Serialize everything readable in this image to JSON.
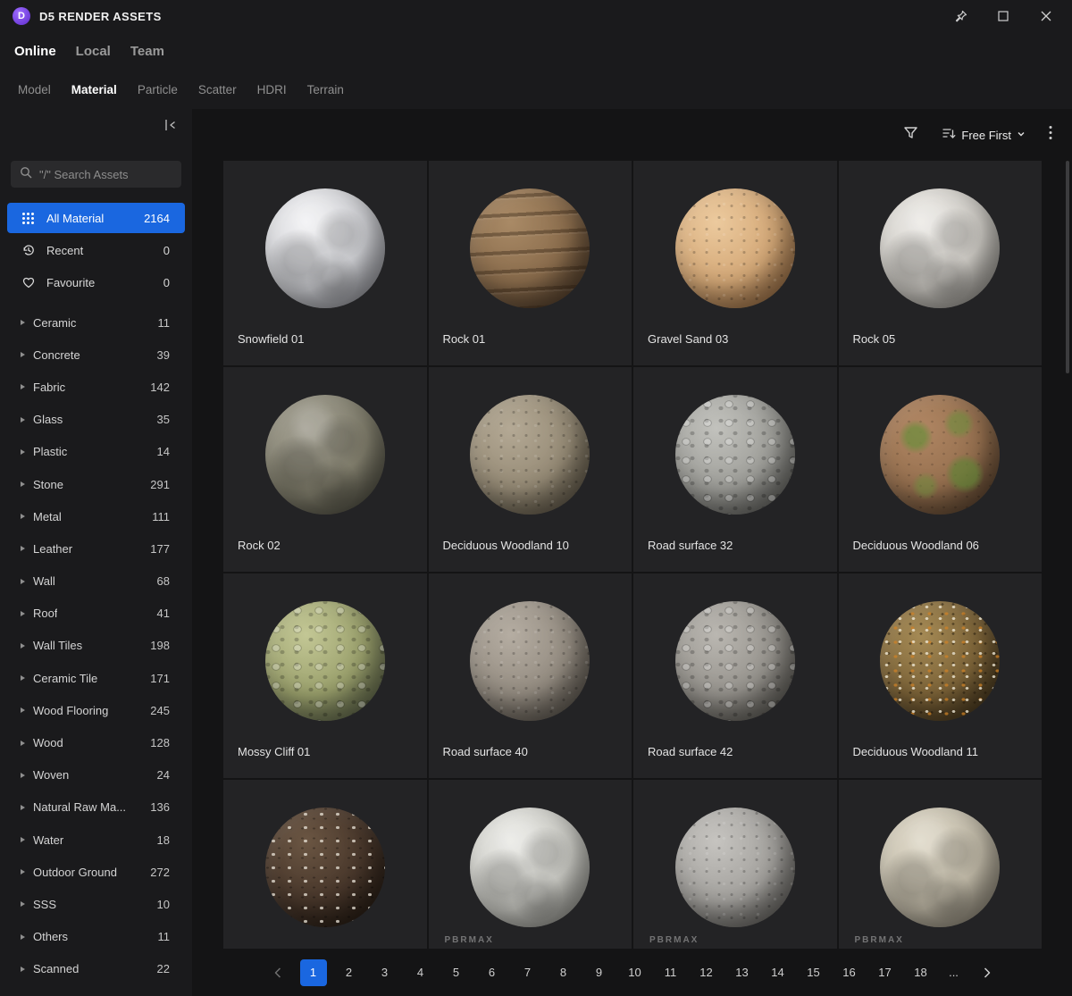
{
  "window": {
    "title": "D5 RENDER ASSETS",
    "logo_letter": "D"
  },
  "colors": {
    "accent": "#1a67e0"
  },
  "source_tabs": [
    {
      "label": "Online",
      "active": true
    },
    {
      "label": "Local",
      "active": false
    },
    {
      "label": "Team",
      "active": false
    }
  ],
  "type_tabs": [
    {
      "label": "Model",
      "active": false
    },
    {
      "label": "Material",
      "active": true
    },
    {
      "label": "Particle",
      "active": false
    },
    {
      "label": "Scatter",
      "active": false
    },
    {
      "label": "HDRI",
      "active": false
    },
    {
      "label": "Terrain",
      "active": false
    }
  ],
  "sidebar": {
    "search": {
      "placeholder": "\"/\" Search Assets"
    },
    "pinned": [
      {
        "label": "All Material",
        "count": "2164",
        "icon": "grid-dots-icon",
        "active": true
      },
      {
        "label": "Recent",
        "count": "0",
        "icon": "history-icon",
        "active": false
      },
      {
        "label": "Favourite",
        "count": "0",
        "icon": "heart-icon",
        "active": false
      }
    ],
    "categories": [
      {
        "label": "Ceramic",
        "count": "11"
      },
      {
        "label": "Concrete",
        "count": "39"
      },
      {
        "label": "Fabric",
        "count": "142"
      },
      {
        "label": "Glass",
        "count": "35"
      },
      {
        "label": "Plastic",
        "count": "14"
      },
      {
        "label": "Stone",
        "count": "291"
      },
      {
        "label": "Metal",
        "count": "111"
      },
      {
        "label": "Leather",
        "count": "177"
      },
      {
        "label": "Wall",
        "count": "68"
      },
      {
        "label": "Roof",
        "count": "41"
      },
      {
        "label": "Wall Tiles",
        "count": "198"
      },
      {
        "label": "Ceramic Tile",
        "count": "171"
      },
      {
        "label": "Wood Flooring",
        "count": "245"
      },
      {
        "label": "Wood",
        "count": "128"
      },
      {
        "label": "Woven",
        "count": "24"
      },
      {
        "label": "Natural Raw Ma...",
        "count": "136"
      },
      {
        "label": "Water",
        "count": "18"
      },
      {
        "label": "Outdoor Ground",
        "count": "272"
      },
      {
        "label": "SSS",
        "count": "10"
      },
      {
        "label": "Others",
        "count": "11"
      },
      {
        "label": "Scanned",
        "count": "22"
      }
    ]
  },
  "toolbar": {
    "sort_label": "Free First"
  },
  "materials": [
    {
      "name": "Snowfield 01",
      "c1": "#f2f2f4",
      "c2": "#cfd0d4",
      "c3": "#8e8f96",
      "texture": "mottle",
      "watermark": ""
    },
    {
      "name": "Rock 01",
      "c1": "#a98a66",
      "c2": "#8a6c4c",
      "c3": "#4e3a28",
      "texture": "striated",
      "watermark": ""
    },
    {
      "name": "Gravel Sand 03",
      "c1": "#ecca9e",
      "c2": "#d4a877",
      "c3": "#97693f",
      "texture": "speckle",
      "watermark": ""
    },
    {
      "name": "Rock 05",
      "c1": "#eceae6",
      "c2": "#cfccc6",
      "c3": "#93908a",
      "texture": "mottle",
      "watermark": ""
    },
    {
      "name": "Rock 02",
      "c1": "#a3a093",
      "c2": "#84816f",
      "c3": "#4b4a3e",
      "texture": "mottle",
      "watermark": ""
    },
    {
      "name": "Deciduous Woodland 10",
      "c1": "#b4a995",
      "c2": "#968b76",
      "c3": "#5c5444",
      "texture": "speckle",
      "watermark": ""
    },
    {
      "name": "Road surface 32",
      "c1": "#c2c2bd",
      "c2": "#9e9e99",
      "c3": "#5f5f5b",
      "texture": "pebble",
      "watermark": ""
    },
    {
      "name": "Deciduous Woodland 06",
      "c1": "#b08663",
      "c2": "#96704f",
      "c3": "#56402c",
      "texture": "moss",
      "watermark": ""
    },
    {
      "name": "Mossy Cliff 01",
      "c1": "#c3c795",
      "c2": "#9aa06c",
      "c3": "#5c644a",
      "texture": "pebble",
      "watermark": ""
    },
    {
      "name": "Road surface 40",
      "c1": "#b5ada2",
      "c2": "#948c81",
      "c3": "#58524a",
      "texture": "speckle",
      "watermark": ""
    },
    {
      "name": "Road surface 42",
      "c1": "#bab7b1",
      "c2": "#96938d",
      "c3": "#585650",
      "texture": "pebble",
      "watermark": ""
    },
    {
      "name": "Deciduous Woodland 11",
      "c1": "#a58a55",
      "c2": "#7c6338",
      "c3": "#41331c",
      "texture": "leaves",
      "watermark": ""
    },
    {
      "name": "",
      "c1": "#6b5643",
      "c2": "#47362a",
      "c3": "#241a12",
      "texture": "speckle-light",
      "watermark": ""
    },
    {
      "name": "",
      "c1": "#eaeae6",
      "c2": "#cbcbc5",
      "c3": "#8f8f89",
      "texture": "mottle",
      "watermark": "PBRMAX"
    },
    {
      "name": "",
      "c1": "#c6c4c0",
      "c2": "#a3a19d",
      "c3": "#5f5d59",
      "texture": "speckle",
      "watermark": "PBRMAX"
    },
    {
      "name": "",
      "c1": "#dfd9c9",
      "c2": "#c2bba9",
      "c3": "#8a8374",
      "texture": "mottle",
      "watermark": "PBRMAX"
    }
  ],
  "pagination": {
    "pages": [
      "1",
      "2",
      "3",
      "4",
      "5",
      "6",
      "7",
      "8",
      "9",
      "10",
      "11",
      "12",
      "13",
      "14",
      "15",
      "16",
      "17",
      "18"
    ],
    "active_page": "1",
    "ellipsis": "..."
  }
}
